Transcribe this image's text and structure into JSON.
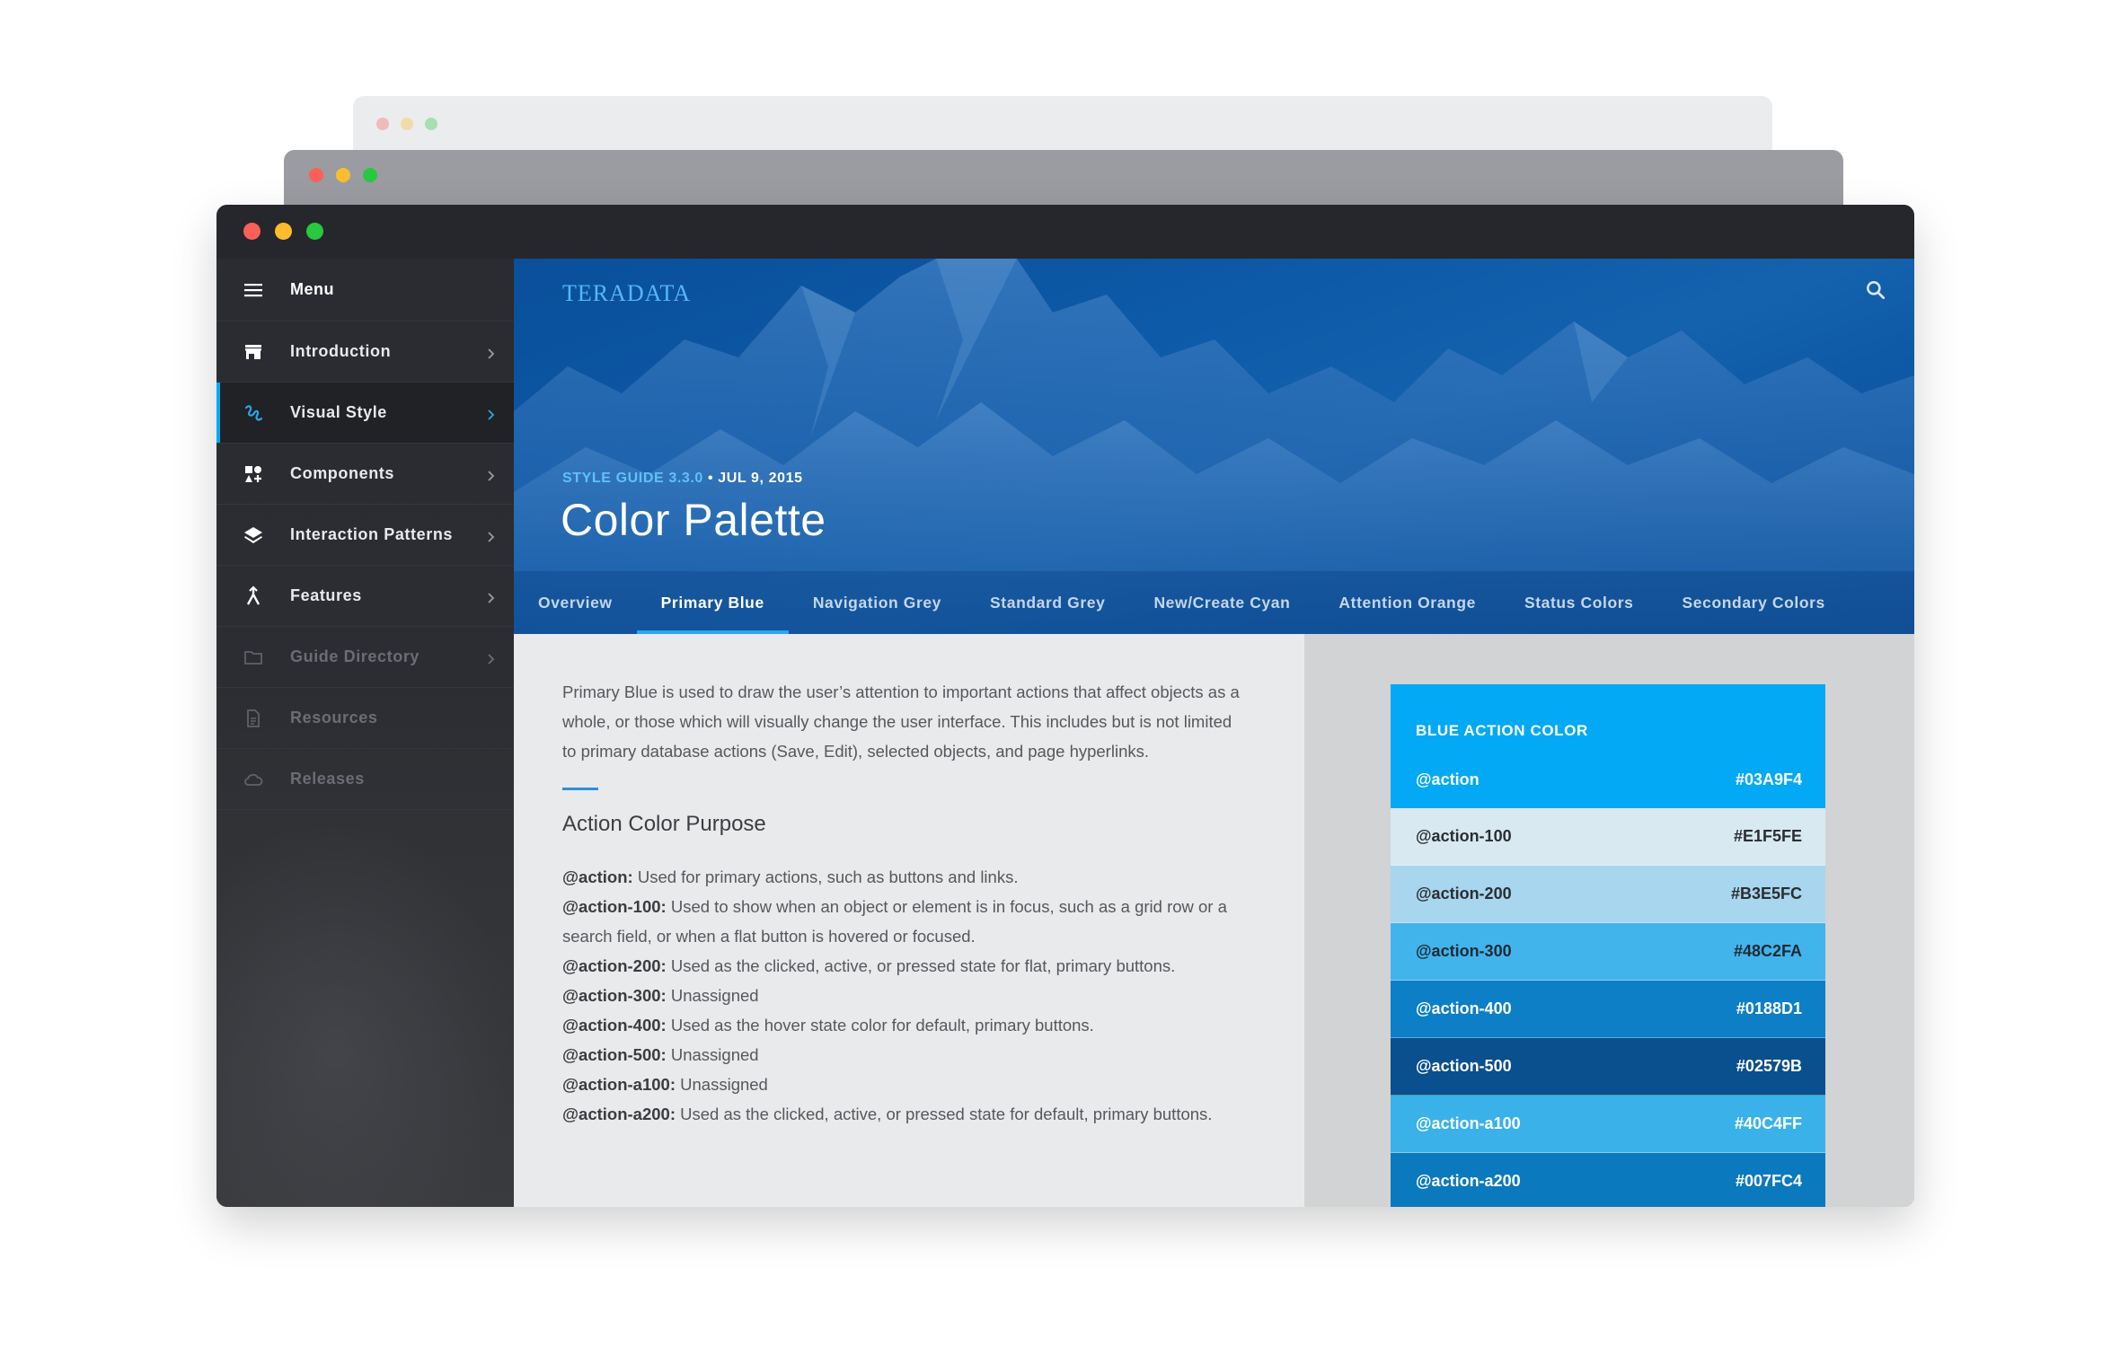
{
  "window": {
    "dot_colors": [
      "#fc5f57",
      "#fdbc2e",
      "#28c840"
    ]
  },
  "sidebar": {
    "menu_label": "Menu",
    "items": [
      {
        "label": "Introduction",
        "icon": "store-icon",
        "active": false,
        "dim": false,
        "chevron": true
      },
      {
        "label": "Visual Style",
        "icon": "brush-icon",
        "active": true,
        "dim": false,
        "chevron": true
      },
      {
        "label": "Components",
        "icon": "components-icon",
        "active": false,
        "dim": false,
        "chevron": true
      },
      {
        "label": "Interaction Patterns",
        "icon": "layers-icon",
        "active": false,
        "dim": false,
        "chevron": true
      },
      {
        "label": "Features",
        "icon": "merge-icon",
        "active": false,
        "dim": false,
        "chevron": true
      },
      {
        "label": "Guide Directory",
        "icon": "folder-icon",
        "active": false,
        "dim": true,
        "chevron": true
      },
      {
        "label": "Resources",
        "icon": "document-icon",
        "active": false,
        "dim": true,
        "chevron": false
      },
      {
        "label": "Releases",
        "icon": "cloud-icon",
        "active": false,
        "dim": true,
        "chevron": false
      }
    ]
  },
  "header": {
    "logo": "TERADATA",
    "version": "STYLE GUIDE 3.3.0",
    "separator": " • ",
    "date": "JUL 9, 2015",
    "title": "Color Palette"
  },
  "tabs": [
    {
      "label": "Overview",
      "active": false
    },
    {
      "label": "Primary Blue",
      "active": true
    },
    {
      "label": "Navigation Grey",
      "active": false
    },
    {
      "label": "Standard Grey",
      "active": false
    },
    {
      "label": "New/Create Cyan",
      "active": false
    },
    {
      "label": "Attention Orange",
      "active": false
    },
    {
      "label": "Status Colors",
      "active": false
    },
    {
      "label": "Secondary Colors",
      "active": false
    }
  ],
  "main": {
    "intro": "Primary Blue is used to draw the user’s attention to important actions that affect objects as a whole, or those which will visually change the user interface. This includes but is not limited to primary database actions (Save, Edit), selected objects, and page hyperlinks.",
    "section_title": "Action Color Purpose",
    "definitions": [
      {
        "term": "@action:",
        "text": " Used for primary actions, such as buttons and links."
      },
      {
        "term": "@action-100:",
        "text": " Used to show when an object or element is in focus, such as a grid row or a search field, or when a flat button is hovered or focused."
      },
      {
        "term": "@action-200:",
        "text": " Used as the clicked, active, or pressed state for flat, primary buttons."
      },
      {
        "term": "@action-300:",
        "text": " Unassigned"
      },
      {
        "term": "@action-400:",
        "text": " Used as the hover state color for default, primary buttons."
      },
      {
        "term": "@action-500:",
        "text": " Unassigned"
      },
      {
        "term": "@action-a100:",
        "text": " Unassigned"
      },
      {
        "term": "@action-a200:",
        "text": " Used as the clicked, active, or pressed state for default, primary buttons."
      }
    ]
  },
  "swatches": {
    "heading": "BLUE ACTION COLOR",
    "primary": {
      "name": "@action",
      "hex": "#03A9F4",
      "bg": "#03a9f4",
      "fg": "#ffffff"
    },
    "rows": [
      {
        "name": "@action-100",
        "hex": "#E1F5FE",
        "bg": "#d8e9f2",
        "fg": "#2b2d31"
      },
      {
        "name": "@action-200",
        "hex": "#B3E5FC",
        "bg": "#a7d6ee",
        "fg": "#2b2d31"
      },
      {
        "name": "@action-300",
        "hex": "#48C2FA",
        "bg": "#42b4ec",
        "fg": "#1f2a35"
      },
      {
        "name": "@action-400",
        "hex": "#0188D1",
        "bg": "#0d7fc6",
        "fg": "#ffffff"
      },
      {
        "name": "@action-500",
        "hex": "#02579B",
        "bg": "#0a4f8e",
        "fg": "#ffffff"
      },
      {
        "name": "@action-a100",
        "hex": "#40C4FF",
        "bg": "#3ab1e8",
        "fg": "#ffffff"
      },
      {
        "name": "@action-a200",
        "hex": "#007FC4",
        "bg": "#0b79bd",
        "fg": "#ffffff"
      }
    ]
  }
}
